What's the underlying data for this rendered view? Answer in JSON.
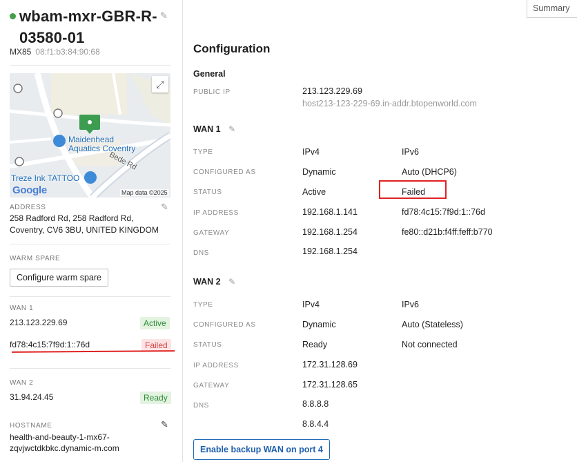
{
  "device": {
    "name": "wbam-mxr-GBR-R-03580-01",
    "model": "MX85",
    "mac": "08:f1:b3:84:90:68",
    "status_color": "#43a047"
  },
  "map": {
    "places": [
      "Maidenhead",
      "Aquatics Coventry",
      "Treze Ink TATTOO"
    ],
    "road": "Bede Rd",
    "logo": "Google",
    "credit": "Map data ©2025"
  },
  "sidebar": {
    "address_label": "ADDRESS",
    "address_lines": [
      "258 Radford Rd, 258 Radford Rd,",
      "Coventry, CV6 3BU, UNITED KINGDOM"
    ],
    "warm_spare_label": "WARM SPARE",
    "warm_spare_button": "Configure warm spare",
    "wan1_label": "WAN 1",
    "wan1_ipv4": "213.123.229.69",
    "wan1_ipv4_status": "Active",
    "wan1_ipv6": "fd78:4c15:7f9d:1::76d",
    "wan1_ipv6_status": "Failed",
    "wan2_label": "WAN 2",
    "wan2_ip": "31.94.24.45",
    "wan2_status": "Ready",
    "hostname_label": "HOSTNAME",
    "hostname_lines": [
      "health-and-beauty-1-mx67-",
      "zqvjwctdkbkc.dynamic-m.com"
    ]
  },
  "main": {
    "summary_tab": "Summary",
    "title": "Configuration",
    "general": {
      "heading": "General",
      "public_ip_label": "PUBLIC IP",
      "public_ip": "213.123.229.69",
      "public_host": "host213-123-229-69.in-addr.btopenworld.com"
    },
    "wan1": {
      "heading": "WAN 1",
      "type_label": "TYPE",
      "type_v4": "IPv4",
      "type_v6": "IPv6",
      "configured_label": "CONFIGURED AS",
      "configured_v4": "Dynamic",
      "configured_v6": "Auto (DHCP6)",
      "status_label": "STATUS",
      "status_v4": "Active",
      "status_v6": "Failed",
      "ip_label": "IP ADDRESS",
      "ip_v4": "192.168.1.141",
      "ip_v6": "fd78:4c15:7f9d:1::76d",
      "gateway_label": "GATEWAY",
      "gateway_v4": "192.168.1.254",
      "gateway_v6": "fe80::d21b:f4ff:feff:b770",
      "dns_label": "DNS",
      "dns_v4": "192.168.1.254"
    },
    "wan2": {
      "heading": "WAN 2",
      "type_label": "TYPE",
      "type_v4": "IPv4",
      "type_v6": "IPv6",
      "configured_label": "CONFIGURED AS",
      "configured_v4": "Dynamic",
      "configured_v6": "Auto (Stateless)",
      "status_label": "STATUS",
      "status_v4": "Ready",
      "status_v6": "Not connected",
      "ip_label": "IP ADDRESS",
      "ip_v4": "172.31.128.69",
      "gateway_label": "GATEWAY",
      "gateway_v4": "172.31.128.65",
      "dns_label": "DNS",
      "dns_v4_1": "8.8.8.8",
      "dns_v4_2": "8.8.4.4"
    },
    "backup_button": "Enable backup WAN on port 4"
  },
  "colors": {
    "accent_blue": "#1e6bb8",
    "success": "#2e8b3a",
    "danger": "#d64545",
    "highlight_red": "#e02020"
  }
}
